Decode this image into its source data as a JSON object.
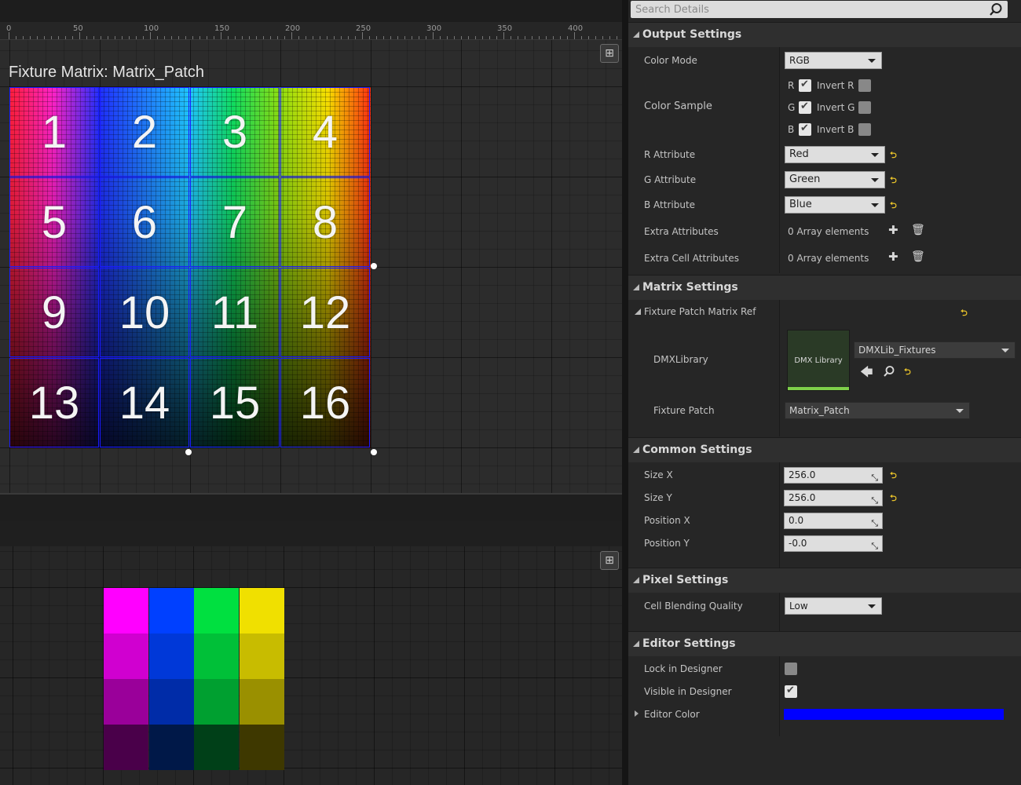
{
  "viewport": {
    "ruler_labels": [
      "0",
      "50",
      "100",
      "150",
      "200",
      "250",
      "300",
      "350",
      "400"
    ],
    "matrix_title": "Fixture Matrix: Matrix_Patch",
    "cells": [
      "1",
      "2",
      "3",
      "4",
      "5",
      "6",
      "7",
      "8",
      "9",
      "10",
      "11",
      "12",
      "13",
      "14",
      "15",
      "16"
    ],
    "fit_icon": "⊞",
    "preview_colors": [
      [
        "#ff00ff",
        "#0040ff",
        "#00e040",
        "#f0e000"
      ],
      [
        "#d000d0",
        "#0038d8",
        "#00c038",
        "#c8bc00"
      ],
      [
        "#9a009a",
        "#002ca8",
        "#00a030",
        "#9a9000"
      ],
      [
        "#4a004a",
        "#001848",
        "#004018",
        "#3e3800"
      ]
    ]
  },
  "details": {
    "search_placeholder": "Search Details",
    "reset_glyph": "⮌",
    "output_settings": {
      "title": "Output Settings",
      "color_mode_label": "Color Mode",
      "color_mode_value": "RGB",
      "color_sample_label": "Color Sample",
      "channels": [
        {
          "name": "R",
          "checked": true,
          "invert_label": "Invert R",
          "invert": false
        },
        {
          "name": "G",
          "checked": true,
          "invert_label": "Invert G",
          "invert": false
        },
        {
          "name": "B",
          "checked": true,
          "invert_label": "Invert B",
          "invert": false
        }
      ],
      "r_attribute_label": "R Attribute",
      "r_attribute_value": "Red",
      "g_attribute_label": "G Attribute",
      "g_attribute_value": "Green",
      "b_attribute_label": "B Attribute",
      "b_attribute_value": "Blue",
      "extra_attributes_label": "Extra Attributes",
      "extra_attributes_value": "0 Array elements",
      "extra_cell_attributes_label": "Extra Cell Attributes",
      "extra_cell_attributes_value": "0 Array elements"
    },
    "matrix_settings": {
      "title": "Matrix Settings",
      "fixture_patch_matrix_ref_label": "Fixture Patch Matrix Ref",
      "dmx_library_label": "DMXLibrary",
      "dmx_library_thumb": "DMX Library",
      "dmx_library_value": "DMXLib_Fixtures",
      "fixture_patch_label": "Fixture Patch",
      "fixture_patch_value": "Matrix_Patch"
    },
    "common_settings": {
      "title": "Common Settings",
      "size_x_label": "Size X",
      "size_x_value": "256.0",
      "size_y_label": "Size Y",
      "size_y_value": "256.0",
      "position_x_label": "Position X",
      "position_x_value": "0.0",
      "position_y_label": "Position Y",
      "position_y_value": "-0.0"
    },
    "pixel_settings": {
      "title": "Pixel Settings",
      "cell_blending_quality_label": "Cell Blending Quality",
      "cell_blending_quality_value": "Low"
    },
    "editor_settings": {
      "title": "Editor Settings",
      "lock_in_designer_label": "Lock in Designer",
      "lock_in_designer": false,
      "visible_in_designer_label": "Visible in Designer",
      "visible_in_designer": true,
      "editor_color_label": "Editor Color",
      "editor_color": "#0000ff"
    }
  }
}
